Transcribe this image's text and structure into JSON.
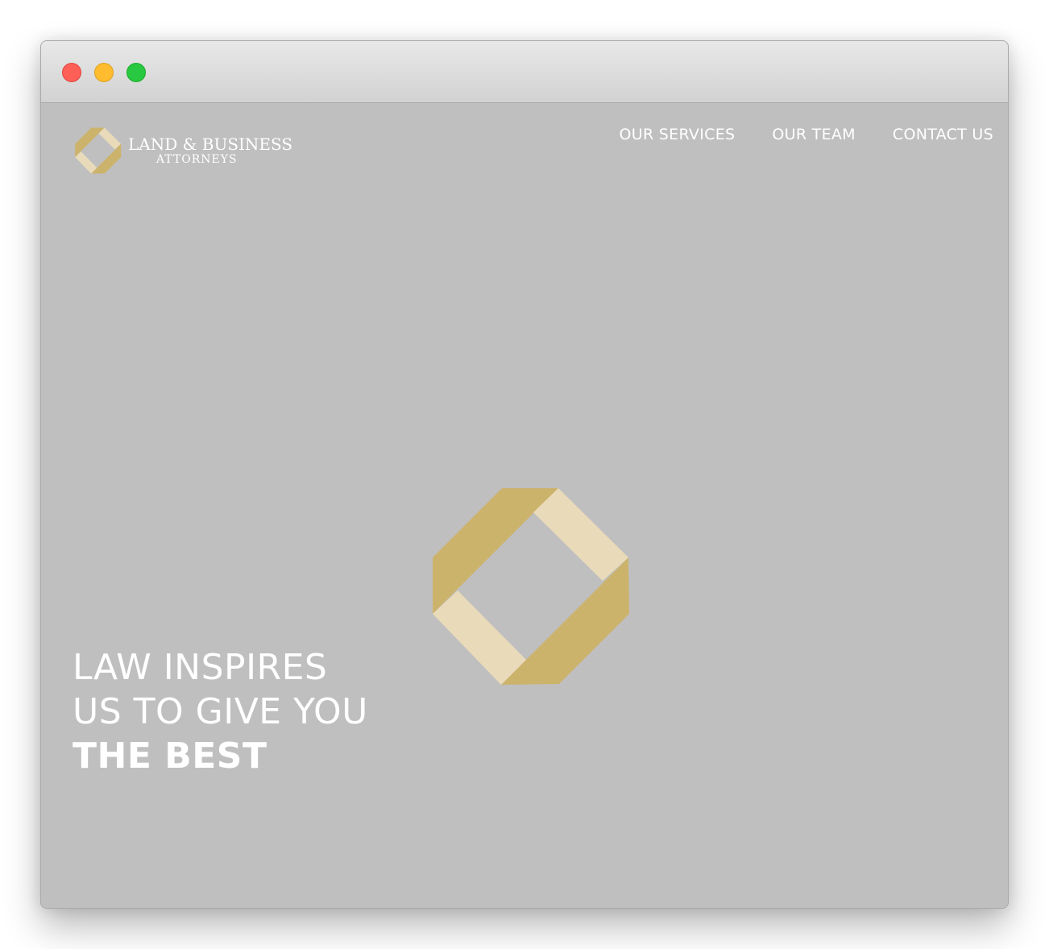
{
  "window": {
    "controls": [
      "close",
      "minimize",
      "maximize"
    ]
  },
  "logo": {
    "line1": "LAND & BUSINESS",
    "line2": "ATTORNEYS",
    "mark_icon": "octagon-ribbon-logo-icon"
  },
  "nav": {
    "items": [
      {
        "label": "OUR SERVICES"
      },
      {
        "label": "OUR TEAM"
      },
      {
        "label": "CONTACT US"
      }
    ]
  },
  "hero": {
    "line1": "LAW INSPIRES",
    "line2": "US TO GIVE YOU",
    "line3": "THE BEST",
    "emblem_icon": "octagon-ribbon-emblem"
  },
  "colors": {
    "background": "#bfbfbf",
    "gold_dark": "#ccb36c",
    "gold_light": "#e9dbba",
    "text": "#ffffff"
  }
}
